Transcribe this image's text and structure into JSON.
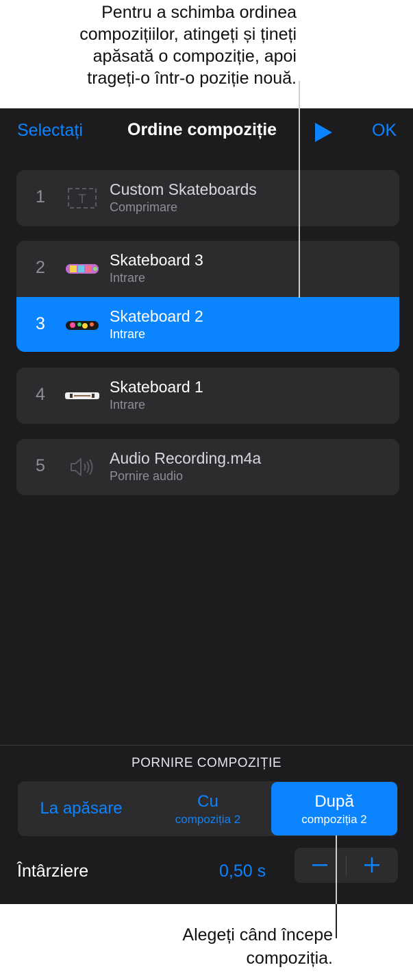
{
  "callouts": {
    "top": [
      "Pentru a schimba ordinea",
      "compozițiilor, atingeți și țineți",
      "apăsată o compoziție, apoi",
      "trageți-o într-o poziție nouă."
    ],
    "bottom": [
      "Alegeți când începe",
      "compoziția."
    ]
  },
  "nav": {
    "select_label": "Selectați",
    "title": "Ordine compoziție",
    "play_icon": "play-icon",
    "ok_label": "OK"
  },
  "builds": [
    {
      "number": "1",
      "name": "Custom Skateboards",
      "sub": "Comprimare",
      "thumb": "text-box-icon"
    },
    {
      "number": "2",
      "name": "Skateboard 3",
      "sub": "Intrare",
      "thumb": "skateboard-3-image"
    },
    {
      "number": "3",
      "name": "Skateboard 2",
      "sub": "Intrare",
      "thumb": "skateboard-2-image",
      "selected": true
    },
    {
      "number": "4",
      "name": "Skateboard 1",
      "sub": "Intrare",
      "thumb": "skateboard-1-image"
    },
    {
      "number": "5",
      "name": "Audio Recording.m4a",
      "sub": "Pornire audio",
      "thumb": "speaker-icon"
    }
  ],
  "start_section": {
    "label": "PORNIRE COMPOZIȚIE",
    "options": [
      {
        "line1": "La apăsare",
        "line2": ""
      },
      {
        "line1": "Cu",
        "line2": "compoziția 2"
      },
      {
        "line1": "După",
        "line2": "compoziția 2"
      }
    ],
    "selected": "După"
  },
  "delay": {
    "label": "Întârziere",
    "value": "0,50 s"
  },
  "colors": {
    "accent": "#0a84ff",
    "panel_bg": "#1c1c1e",
    "row_bg": "#2c2c2e"
  }
}
